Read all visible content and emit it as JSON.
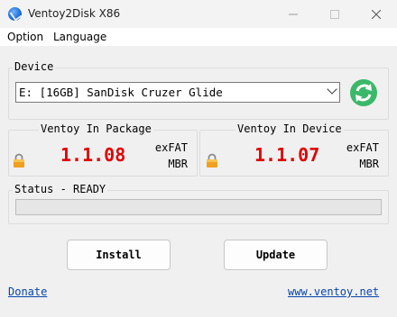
{
  "window": {
    "title": "Ventoy2Disk  X86"
  },
  "menu": {
    "items": [
      "Option",
      "Language"
    ]
  },
  "device": {
    "group_label": "Device",
    "selected": "E: [16GB] SanDisk Cruzer Glide"
  },
  "package": {
    "label": "Ventoy In Package",
    "version": "1.1.08",
    "fs": "exFAT",
    "part": "MBR"
  },
  "installed": {
    "label": "Ventoy In Device",
    "version": "1.1.07",
    "fs": "exFAT",
    "part": "MBR"
  },
  "status": {
    "text": "Status - READY",
    "progress": 0
  },
  "buttons": {
    "install": "Install",
    "update": "Update"
  },
  "links": {
    "donate": "Donate",
    "site": "www.ventoy.net"
  },
  "colors": {
    "version": "#e00000",
    "refresh": "#3bb86a",
    "link": "#0645ad"
  },
  "icons": [
    "app-icon",
    "minimize-icon",
    "maximize-icon",
    "close-icon",
    "refresh-icon",
    "lock-icon",
    "dropdown-chevron-icon"
  ]
}
